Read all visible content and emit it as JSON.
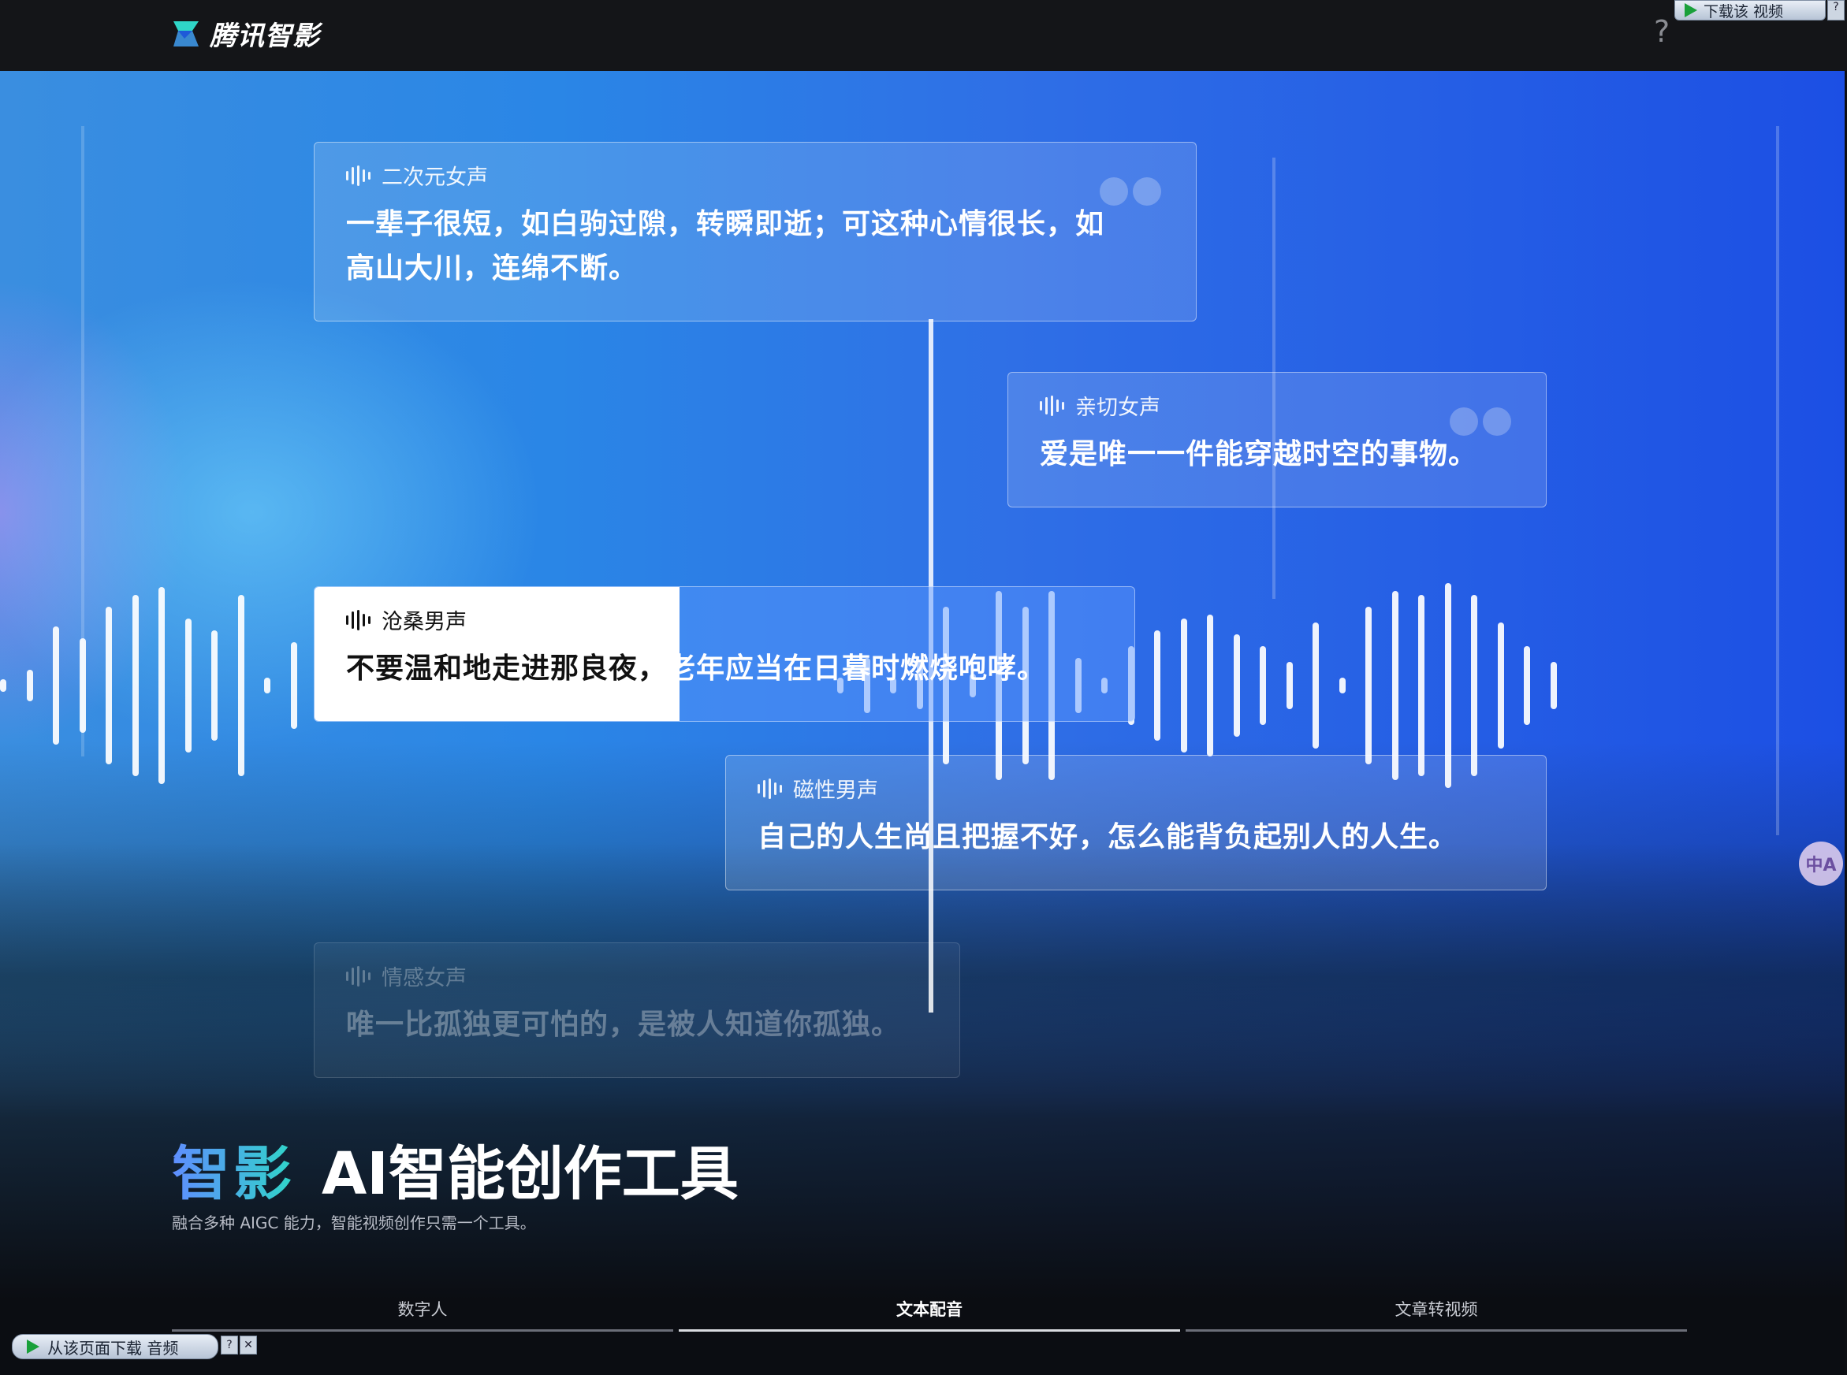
{
  "header": {
    "logo_text": "腾讯智影",
    "help": "?",
    "download_video": "下载该 视频",
    "download_video_help": "?"
  },
  "cards": [
    {
      "voice": "二次元女声",
      "text_line1": "一辈子很短，如白驹过隙，转瞬即逝；可这种心情很长，如",
      "text_line2": "高山大川，连绵不断。"
    },
    {
      "voice": "亲切女声",
      "text": "爱是唯一一件能穿越时空的事物。"
    },
    {
      "voice": "沧桑男声",
      "text_played": "不要温和地走进那良夜，",
      "text_rest": "老年应当在日暮时燃烧咆哮。"
    },
    {
      "voice": "磁性男声",
      "text": "自己的人生尚且把握不好，怎么能背负起别人的人生。"
    },
    {
      "voice": "情感女声",
      "text": "唯一比孤独更可怕的，是被人知道你孤独。"
    }
  ],
  "hero": {
    "brand": "智影",
    "title": "AI智能创作工具",
    "subtitle": "融合多种 AIGC 能力，智能视频创作只需一个工具。"
  },
  "tabs": [
    {
      "label": "数字人",
      "selected": false
    },
    {
      "label": "文本配音",
      "selected": true
    },
    {
      "label": "文章转视频",
      "selected": false
    }
  ],
  "browser_ext": {
    "download_audio": "从该页面下载 音频",
    "help": "?",
    "close": "✕",
    "translate_icon": "translate-icon"
  },
  "colors": {
    "topbar": "#141518",
    "brand_gradient_start": "#5f8dff",
    "brand_gradient_end": "#2fd6c8",
    "logo_mark_top": "#2fd6c8",
    "logo_mark_bottom": "#5f8dff"
  }
}
